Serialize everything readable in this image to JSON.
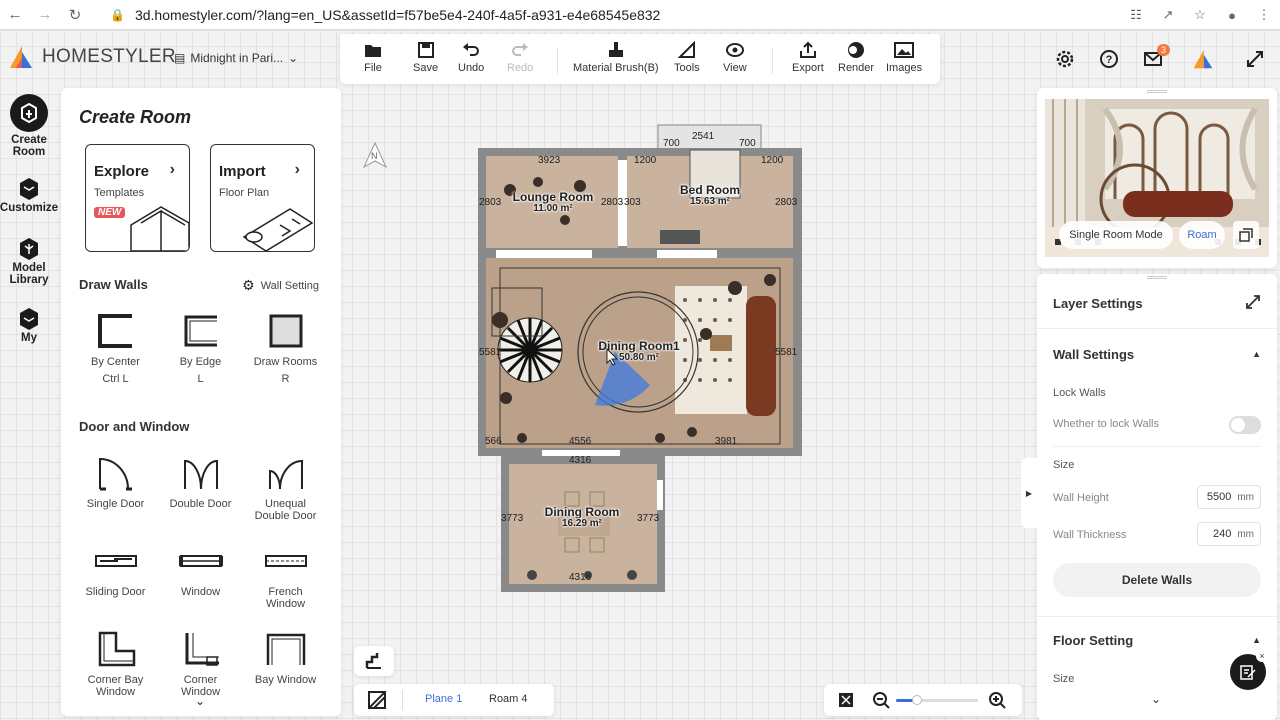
{
  "browser": {
    "url": "3d.homestyler.com/?lang=en_US&assetId=f57be5e4-240f-4a5f-a931-e4e68545e832"
  },
  "header": {
    "logo_text": "HOMESTYLER",
    "project_name": "Midnight in Pari..."
  },
  "toolbar": {
    "file": "File",
    "save": "Save",
    "undo": "Undo",
    "redo": "Redo",
    "material_brush": "Material Brush(B)",
    "tools": "Tools",
    "view": "View",
    "export": "Export",
    "render": "Render",
    "images": "Images"
  },
  "notifications": {
    "count": "3"
  },
  "rail": {
    "create_room": "Create Room",
    "customize": "Customize",
    "model_library": "Model Library",
    "my": "My"
  },
  "create_panel": {
    "title": "Create Room",
    "explore_title": "Explore",
    "explore_sub": "Templates",
    "new_badge": "NEW",
    "import_title": "Import",
    "import_sub": "Floor Plan",
    "draw_walls": "Draw Walls",
    "wall_setting": "Wall Setting",
    "by_center": "By Center",
    "by_center_key": "Ctrl L",
    "by_edge": "By Edge",
    "by_edge_key": "L",
    "draw_rooms": "Draw Rooms",
    "draw_rooms_key": "R",
    "door_window": "Door and Window",
    "single_door": "Single Door",
    "double_door": "Double Door",
    "unequal_double_door": "Unequal Double Door",
    "sliding_door": "Sliding Door",
    "window": "Window",
    "french_window": "French Window",
    "corner_bay_window": "Corner Bay Window",
    "corner_window": "Corner Window",
    "bay_window": "Bay Window"
  },
  "plan": {
    "compass": "N",
    "rooms": [
      {
        "name": "Lounge Room",
        "area": "11.00 m²"
      },
      {
        "name": "Bed Room",
        "area": "15.63 m²"
      },
      {
        "name": "Dining Room1",
        "area": "50.80 m²"
      },
      {
        "name": "Dining Room",
        "area": "16.29 m²"
      }
    ],
    "dims": {
      "d2541": "2541",
      "d700a": "700",
      "d700b": "700",
      "d3923": "3923",
      "d1200a": "1200",
      "d1200b": "1200",
      "d2803a": "2803",
      "d2803b": "2803",
      "d303": "303",
      "d2803c": "2803",
      "d5581a": "5581",
      "d5581b": "5581",
      "d566": "566",
      "d4556": "4556",
      "d3981": "3981",
      "d4316a": "4316",
      "d3773a": "3773",
      "d3773b": "3773",
      "d4316b": "4316"
    }
  },
  "preview": {
    "single_room_mode": "Single Room Mode",
    "roam": "Roam"
  },
  "settings": {
    "layer_settings": "Layer Settings",
    "wall_settings": "Wall Settings",
    "lock_walls": "Lock Walls",
    "whether_lock": "Whether to lock Walls",
    "size": "Size",
    "wall_height": "Wall Height",
    "wall_height_value": "5500",
    "wall_thickness": "Wall Thickness",
    "wall_thickness_value": "240",
    "unit": "mm",
    "delete_walls": "Delete Walls",
    "floor_setting": "Floor Setting",
    "floor_size": "Size"
  },
  "bottom": {
    "plane": "Plane 1",
    "roam": "Roam 4"
  },
  "colors": {
    "accent": "#3d6fd8",
    "brand_orange": "#f39a2b",
    "badge_red": "#e9565a"
  }
}
